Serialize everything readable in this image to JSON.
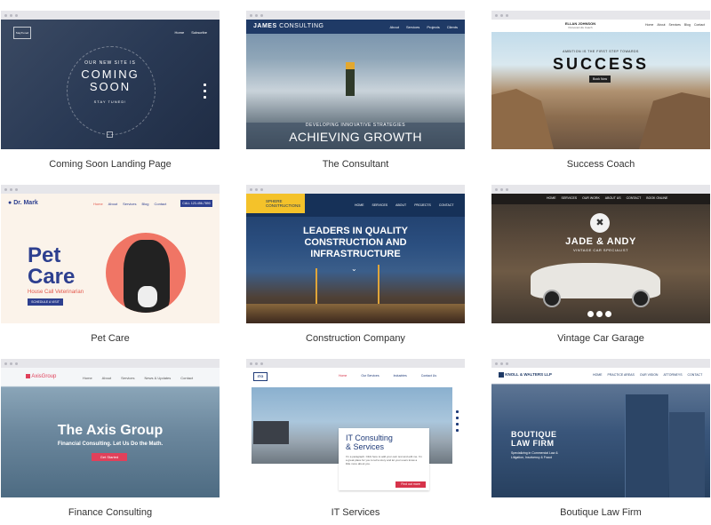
{
  "templates": [
    {
      "caption": "Coming Soon Landing Page",
      "site": {
        "logo": "StayTuned",
        "nav": [
          "Home",
          "Subscribe"
        ],
        "eyebrow": "OUR NEW SITE IS",
        "headline_1": "COMING",
        "headline_2": "SOON",
        "sub": "STAY TUNED!"
      }
    },
    {
      "caption": "The Consultant",
      "site": {
        "brand_1": "JAMES",
        "brand_2": "CONSULTING",
        "nav": [
          "About",
          "Services",
          "Projects",
          "Clients"
        ],
        "eyebrow": "DEVELOPING INNOVATIVE STRATEGIES",
        "headline": "ACHIEVING GROWTH"
      }
    },
    {
      "caption": "Success Coach",
      "site": {
        "brand": "ELLAN JOHNSON",
        "tagline": "Personal Life Coach",
        "nav": [
          "Home",
          "About",
          "Services",
          "Blog",
          "Contact"
        ],
        "eyebrow": "AMBITION IS THE FIRST STEP TOWARDS",
        "headline": "SUCCESS",
        "button": "Book Now"
      }
    },
    {
      "caption": "Pet Care",
      "site": {
        "brand": "Dr. Mark",
        "nav": [
          "Home",
          "About",
          "Services",
          "Blog",
          "Contact"
        ],
        "phone": "CALL 123-456-7890",
        "headline_1": "Pet",
        "headline_2": "Care",
        "sub": "House Call Veterinarian",
        "button": "SCHEDULE A VISIT"
      }
    },
    {
      "caption": "Construction Company",
      "site": {
        "brand_1": "SPHERE",
        "brand_2": "CONSTRUCTIONS",
        "nav": [
          "HOME",
          "SERVICES",
          "ABOUT",
          "PROJECTS",
          "CONTACT"
        ],
        "headline_1": "LEADERS IN QUALITY",
        "headline_2": "CONSTRUCTION AND",
        "headline_3": "INFRASTRUCTURE"
      }
    },
    {
      "caption": "Vintage Car Garage",
      "site": {
        "nav": [
          "HOME",
          "SERVICES",
          "OUR WORK",
          "ABOUT US",
          "CONTACT",
          "BOOK ONLINE"
        ],
        "headline": "JADE & ANDY",
        "sub": "VINTAGE CAR SPECIALIST"
      }
    },
    {
      "caption": "Finance Consulting",
      "site": {
        "brand": "AxisGroup",
        "nav": [
          "Home",
          "About",
          "Services",
          "News & Updates",
          "Contact"
        ],
        "headline": "The Axis Group",
        "sub": "Financial Consulting. Let Us Do the Math.",
        "button": "Get Started"
      }
    },
    {
      "caption": "IT Services",
      "site": {
        "logo": "ITG",
        "nav": [
          "Home",
          "Our Services",
          "Industries",
          "Contact Us"
        ],
        "headline_1": "IT Consulting",
        "headline_2": "& Services",
        "body": "I'm a paragraph. Click here to add your own text and edit me. I'm a great place for you to tell a story and let your users know a little more about you.",
        "button": "Find out more"
      }
    },
    {
      "caption": "Boutique Law Firm",
      "site": {
        "brand": "KNOLL & WALTERS LLP",
        "nav": [
          "HOME",
          "PRACTICE AREAS",
          "OUR VISION",
          "ATTORNEYS",
          "CONTACT"
        ],
        "headline_1": "BOUTIQUE",
        "headline_2": "LAW FIRM",
        "sub_1": "Specializing in Commercial Law &",
        "sub_2": "Litigation, Insolvency & Fraud"
      }
    }
  ]
}
